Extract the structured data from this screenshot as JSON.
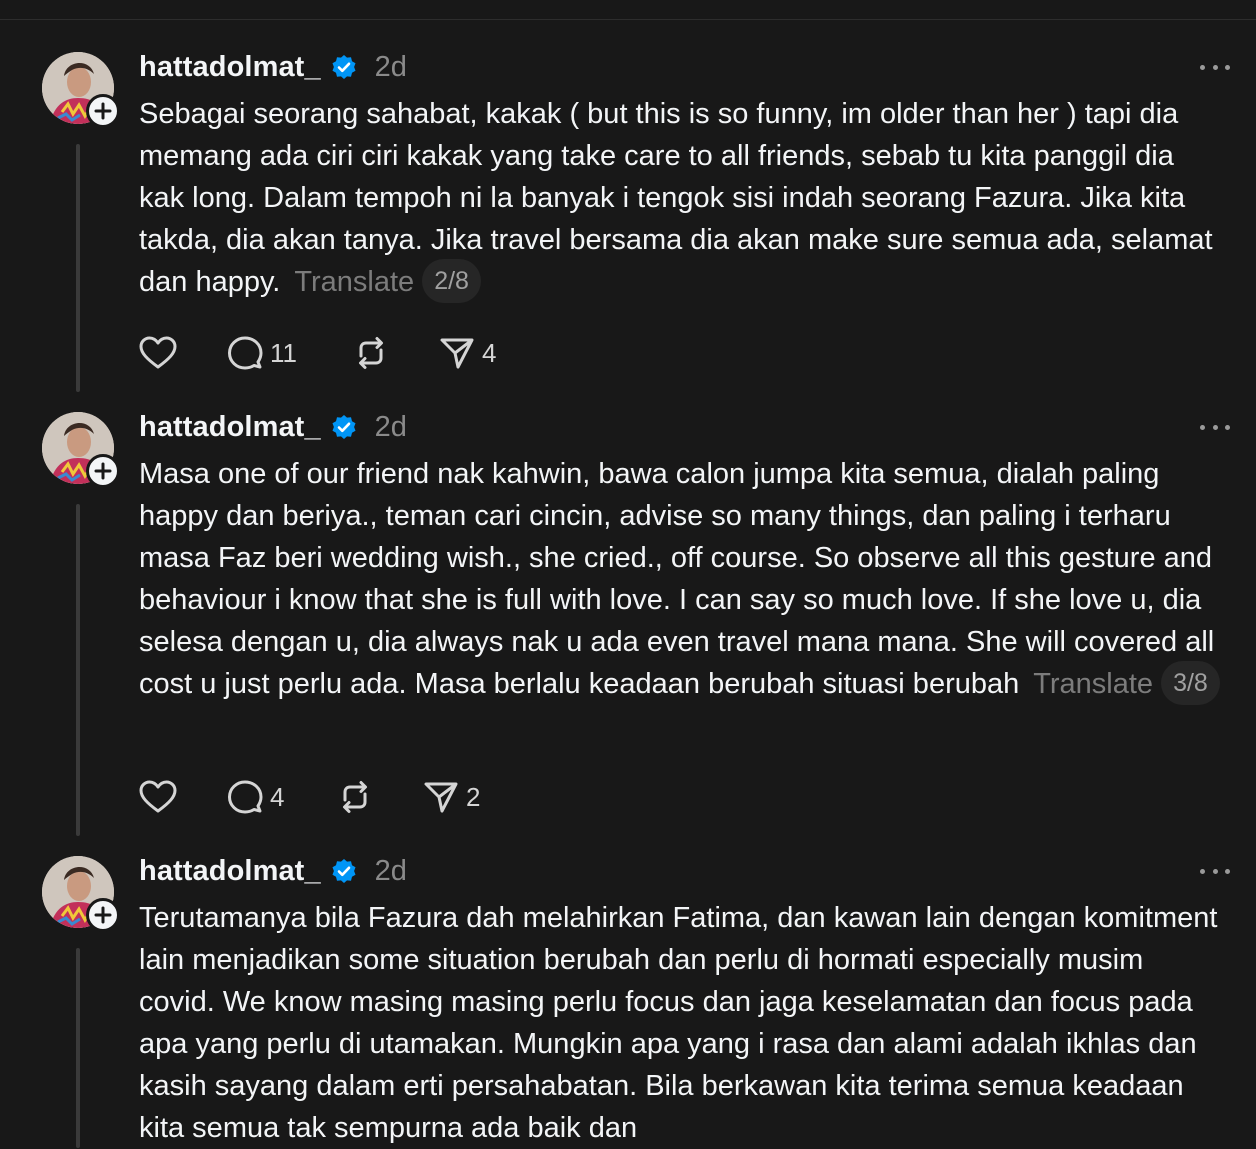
{
  "posts": [
    {
      "username": "hattadolmat_",
      "time": "2d",
      "text": "Sebagai seorang sahabat, kakak ( but this is so funny, im older than her ) tapi dia memang ada ciri ciri kakak yang take care to all friends, sebab tu kita panggil dia kak long. Dalam tempoh ni la banyak i tengok sisi indah seorang Fazura. Jika kita takda, dia akan tanya. Jika travel bersama dia akan make sure semua ada, selamat dan happy.",
      "translate_label": "Translate",
      "counter": "2/8",
      "like_count": "",
      "reply_count": "11",
      "repost_count": "",
      "share_count": "4"
    },
    {
      "username": "hattadolmat_",
      "time": "2d",
      "text": "Masa one of our friend nak kahwin, bawa calon jumpa kita semua, dialah paling happy dan beriya., teman cari cincin, advise so many things, dan paling i terharu masa Faz beri wedding wish., she cried., off course. So observe all this gesture and behaviour i know that she is full with love. I can say so much love. If she love u, dia selesa dengan u, dia always nak u ada even travel mana mana. She will covered all cost u just perlu ada. Masa berlalu keadaan berubah situasi berubah",
      "translate_label": "Translate",
      "counter": "3/8",
      "like_count": "",
      "reply_count": "4",
      "repost_count": "",
      "share_count": "2"
    },
    {
      "username": "hattadolmat_",
      "time": "2d",
      "text": "Terutamanya bila Fazura dah melahirkan Fatima, dan kawan lain dengan komitment lain menjadikan some situation berubah dan perlu di hormati especially musim covid. We know masing masing perlu focus dan jaga keselamatan dan focus pada apa yang perlu di utamakan. Mungkin apa yang i rasa dan alami adalah ikhlas dan kasih sayang dalam erti persahabatan. Bila berkawan kita terima semua keadaan kita semua tak sempurna ada baik dan"
    }
  ],
  "icons": {
    "verified": "verified-badge-icon",
    "more": "more-options-icon",
    "like": "heart-icon",
    "reply": "comment-icon",
    "repost": "repost-icon",
    "share": "send-icon",
    "follow": "plus-icon"
  },
  "colors": {
    "background": "#181818",
    "text": "#f3f5f7",
    "muted": "#8a8a8a",
    "verified": "#0095f6"
  }
}
